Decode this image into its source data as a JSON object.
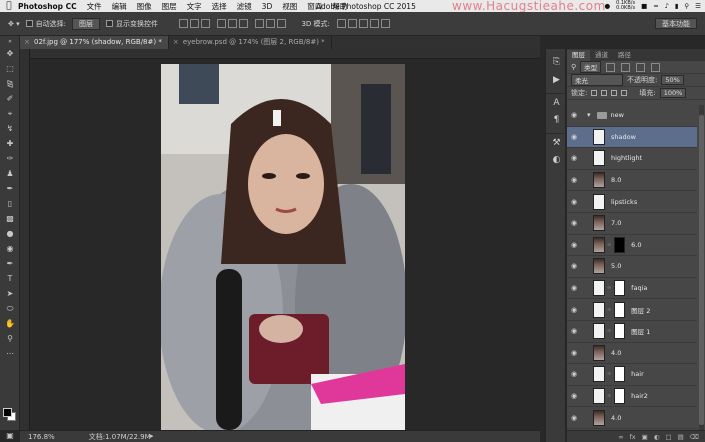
{
  "menubar": {
    "app": "Photoshop CC",
    "menus": [
      "文件",
      "编辑",
      "图像",
      "图层",
      "文字",
      "选择",
      "滤镜",
      "3D",
      "视图",
      "窗口",
      "帮助"
    ],
    "window_title": "Adobe Photoshop CC 2015",
    "net_up": "0.1KB/s",
    "net_down": "0.0KB/s",
    "watermark": "www.Hacugstieahe.com"
  },
  "options": {
    "auto_select_label": "自动选择:",
    "auto_select_value": "图层",
    "show_transform_label": "显示变换控件",
    "mode_3d": "3D 模式:",
    "workspace": "基本功能"
  },
  "tabs": [
    {
      "label": "02f.jpg @ 177% (shadow, RGB/8#) *",
      "active": true
    },
    {
      "label": "eyebrow.psd @ 174% (图层 2, RGB/8#) *",
      "active": false
    }
  ],
  "status": {
    "zoom": "176.8%",
    "doc": "文档:1.07M/22.9M"
  },
  "panel": {
    "tabs": [
      "图层",
      "通道",
      "路径"
    ],
    "filter_label": "类型",
    "blend_mode": "柔光",
    "opacity_label": "不透明度:",
    "opacity_value": "50%",
    "lock_label": "锁定:",
    "fill_label": "填充:",
    "fill_value": "100%"
  },
  "layers": [
    {
      "name": "new",
      "kind": "group"
    },
    {
      "name": "shadow",
      "kind": "white",
      "selected": true
    },
    {
      "name": "hightlight",
      "kind": "white"
    },
    {
      "name": "8.0",
      "kind": "photo"
    },
    {
      "name": "lipsticks",
      "kind": "white"
    },
    {
      "name": "7.0",
      "kind": "photo"
    },
    {
      "name": "6.0",
      "kind": "photo-mask-black"
    },
    {
      "name": "5.0",
      "kind": "photo"
    },
    {
      "name": "faqia",
      "kind": "white-mask"
    },
    {
      "name": "图层 2",
      "kind": "white-mask"
    },
    {
      "name": "图层 1",
      "kind": "white-mask"
    },
    {
      "name": "4.0",
      "kind": "photo"
    },
    {
      "name": "hair",
      "kind": "white-mask"
    },
    {
      "name": "hair2",
      "kind": "white-mask"
    },
    {
      "name": "4.0",
      "kind": "photo"
    }
  ]
}
